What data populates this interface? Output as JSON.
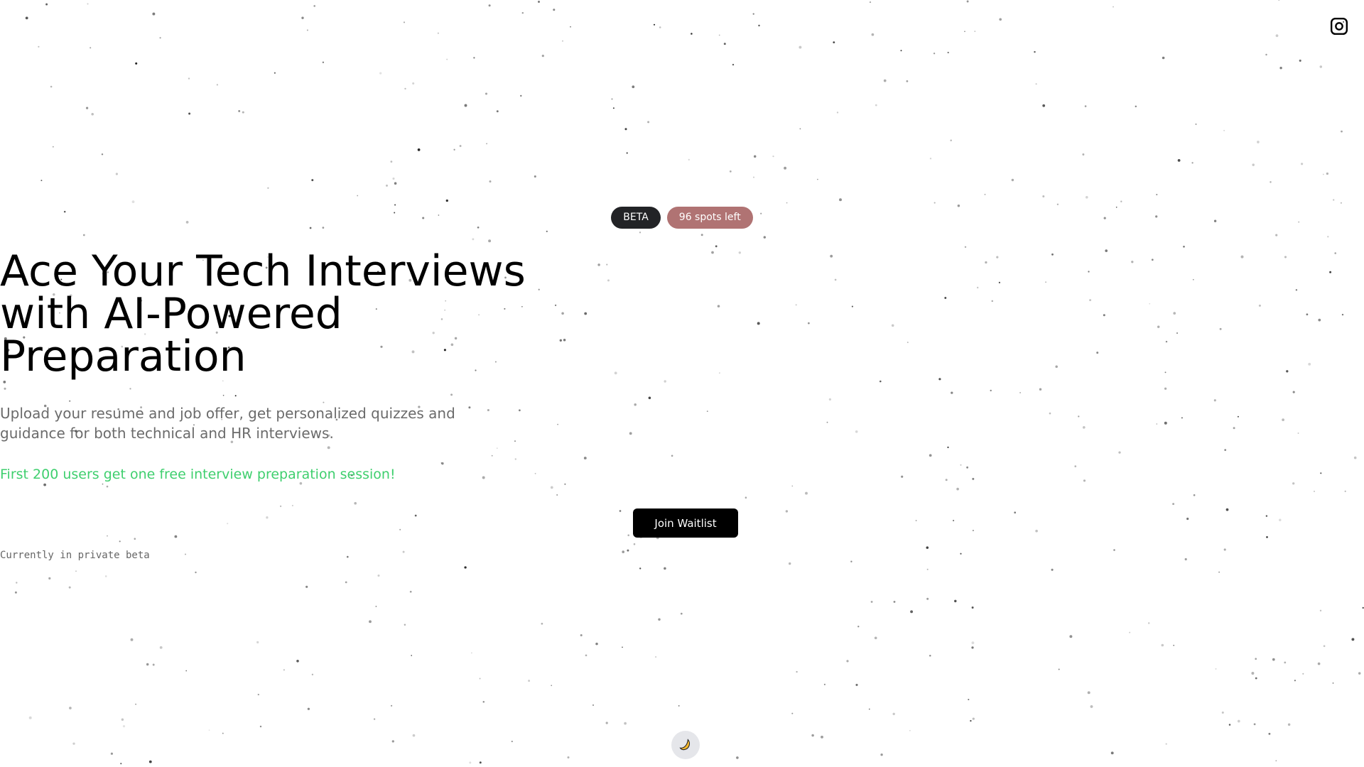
{
  "header": {
    "social_icon": "instagram-icon"
  },
  "badges": {
    "beta": "BETA",
    "spots": "96 spots left"
  },
  "hero": {
    "title_lines": [
      "Ace Your Tech Interviews",
      "with AI-Powered",
      "Preparation"
    ],
    "subtitle_lines": [
      "Upload your resume and job offer, get personalized quizzes and",
      "guidance for both technical and HR interviews."
    ],
    "promo": "First 200 users get one free interview preparation session!",
    "cta_label": "Join Waitlist",
    "note": "Currently in private beta"
  },
  "theme_toggle": {
    "icon": "moon-icon"
  },
  "colors": {
    "beta_badge": "#222326",
    "spots_badge": "#b07373",
    "promo": "#3fcf6e",
    "cta": "#000000"
  }
}
